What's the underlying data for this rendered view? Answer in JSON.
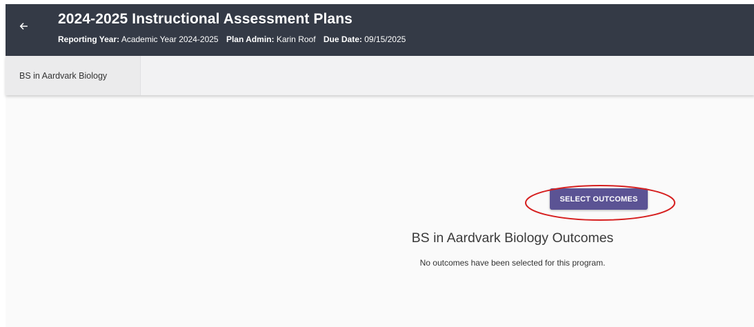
{
  "header": {
    "title": "2024-2025 Instructional Assessment Plans",
    "reporting_year_label": "Reporting Year:",
    "reporting_year_value": "Academic Year 2024-2025",
    "plan_admin_label": "Plan Admin:",
    "plan_admin_value": "Karin Roof",
    "due_date_label": "Due Date:",
    "due_date_value": "09/15/2025",
    "background_color": "#343a46"
  },
  "tabs": [
    {
      "label": "BS in Aardvark Biology"
    }
  ],
  "main": {
    "outcomes_title": "BS in Aardvark Biology Outcomes",
    "empty_message": "No outcomes have been selected for this program.",
    "select_button_label": "SELECT OUTCOMES",
    "button_color": "#5b5394",
    "annotation_color": "#d61f1f"
  },
  "icons": {
    "back": "arrow-left-icon"
  }
}
